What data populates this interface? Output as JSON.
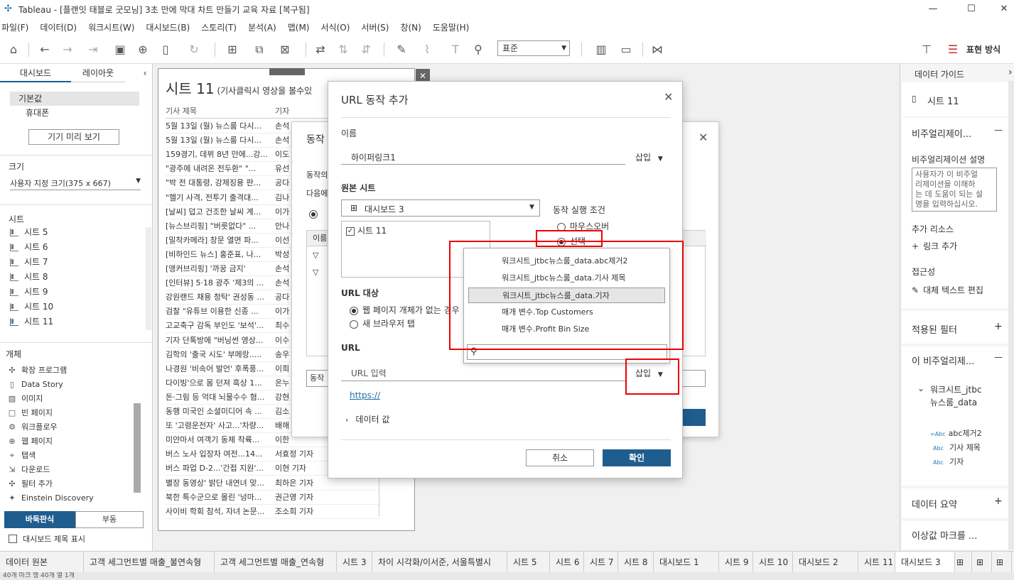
{
  "window": {
    "title": "Tableau - [플랜잇 태블로 굿모닝] 3초 만에 막대 차트 만들기 교육 자료 [복구됨]",
    "minimize": "—",
    "maximize": "☐",
    "close": "✕"
  },
  "menu": [
    "파일(F)",
    "데이터(D)",
    "워크시트(W)",
    "대시보드(B)",
    "스토리(T)",
    "분석(A)",
    "맵(M)",
    "서식(O)",
    "서버(S)",
    "창(N)",
    "도움말(H)"
  ],
  "toolbar": {
    "view_size": "표준",
    "show_me": "표현 방식"
  },
  "left": {
    "tab_dashboard": "대시보드",
    "tab_layout": "레이아웃",
    "device_default": "기본값",
    "device_phone": "휴대폰",
    "preview_button": "기기 미리 보기",
    "size_title": "크기",
    "size_value": "사용자 지정 크기(375 x 667)",
    "sheets_title": "시트",
    "sheets": [
      "시트 5",
      "시트 6",
      "시트 7",
      "시트 8",
      "시트 9",
      "시트 10",
      "시트 11"
    ],
    "objects_title": "개체",
    "objects": [
      "확장 프로그램",
      "Data Story",
      "이미지",
      "빈 페이지",
      "워크플로우",
      "웹 페이지",
      "탭색",
      "다운로드",
      "필터 추가",
      "Einstein Discovery"
    ],
    "tiled": "바둑판식",
    "floating": "부동",
    "show_title": "대시보드 제목 표시"
  },
  "sheet": {
    "title": "시트 11",
    "subtitle": "(기사클릭시 영상을 볼수있",
    "col1": "기사 제목",
    "col2": "기자",
    "rows": [
      [
        "5월 13일 (월) 뉴스룸 다시...",
        "손석"
      ],
      [
        "5월 13일 (월) 뉴스룸 다시...",
        "손석"
      ],
      [
        "159경기, 데뷔 8년 만에...강...",
        "이도"
      ],
      [
        "\"광주에 내려온 전두환\" \"...",
        "유선"
      ],
      [
        "\"박 전 대통령, 강제징용 판...",
        "공다"
      ],
      [
        "\"헬기 사격, 전투기 출격대...",
        "김나"
      ],
      [
        "[날씨] 덥고 건조한 날씨 계...",
        "이가"
      ],
      [
        "[뉴스브리핑] \"버릇없다\" ...",
        "안나"
      ],
      [
        "[밀착카메라] 창문 열면 파...",
        "이선"
      ],
      [
        "[비하인드 뉴스] 홍준표, 나...",
        "박성"
      ],
      [
        "[앵커브리핑] '까꿍 금지'",
        "손석"
      ],
      [
        "[인터뷰] 5·18 광주 '제3의 ...",
        "손석"
      ],
      [
        "강원랜드 채용 청탁' 권성동 ...",
        "공다"
      ],
      [
        "검찰 \"유튜브 이용한 신종 ...",
        "이가"
      ],
      [
        "고교축구 감독 부인도 '보석'...",
        "최수"
      ],
      [
        "기자 단톡방에 \"버닝썬 영상...",
        "이수"
      ],
      [
        "김학의 '출국 시도' 부메랑.....",
        "송우"
      ],
      [
        "나경원 '비속어 발언' 후폭풍...",
        "이희"
      ],
      [
        "다이빙'으로 몸 던져 흑상 1...",
        "온누"
      ],
      [
        "돈·그림 등 억대 뇌물수수 혐...",
        "강현"
      ],
      [
        "동행 미국인 소셜미디어 속 ...",
        "김소"
      ],
      [
        "또 '고령운전자' 사고...'차량...",
        "배해"
      ],
      [
        "미얀마서 여객기 동체 착륙...",
        "이한"
      ],
      [
        "버스 노사 입장차 여전...14...",
        "서효정 기자"
      ],
      [
        "버스 파업 D-2...'간접 지원'...",
        "이현 기자"
      ],
      [
        "별장 동영상' 밝단 내연녀 맞...",
        "최하은 기자"
      ],
      [
        "북한 특수군으로 몰린 '넝마...",
        "권근영 기자"
      ],
      [
        "사이비 학회 참석, 자녀 논문...",
        "조소희 기자"
      ]
    ]
  },
  "action_dialog": {
    "title": "동작",
    "line1": "동작의",
    "line2": "다음에",
    "col_name": "이름",
    "action_btn": "동작"
  },
  "url_dialog": {
    "title": "URL 동작 추가",
    "name_label": "이름",
    "name_value": "하이퍼링크1",
    "insert": "삽입",
    "source_label": "원본 시트",
    "source_value": "대시보드 3",
    "source_sheet": "시트 11",
    "run_label": "동작 실행 조건",
    "run_hover": "마우스오버",
    "run_select": "선택",
    "target_label": "URL 대상",
    "target_1": "웹 페이지 개체가 없는 경우",
    "target_2": "새 브라우저 탭",
    "url_label": "URL",
    "url_placeholder": "URL 입력",
    "url_preview": "https://",
    "data_values": "데이터 값",
    "cancel": "취소",
    "ok": "확인"
  },
  "insert_menu": [
    "워크시트_jtbc뉴스룸_data.abc제거2",
    "워크시트_jtbc뉴스룸_data.기사 제목",
    "워크시트_jtbc뉴스룸_data.기자",
    "매개 변수.Top Customers",
    "매개 변수.Profit Bin Size"
  ],
  "right": {
    "guide_title": "데이터 가이드",
    "sheet": "시트 11",
    "viz_section": "비주얼리제이...",
    "viz_desc_label": "비주얼리제이션 설명",
    "viz_desc_text": [
      "사용자가 이 비주얼",
      "리제이션을 이해하",
      "는 데 도움이 되는 설",
      "명을 입력하십시오."
    ],
    "resources": "추가 리소스",
    "add_link": "링크 추가",
    "accessibility": "접근성",
    "alt_text": "대체 텍스트 편집",
    "filters": "적용된 필터",
    "this_viz": "이 비주얼리제...",
    "datasource": [
      "워크시트_jtbc",
      "뉴스룸_data"
    ],
    "fields": [
      "abc제거2",
      "기사 제목",
      "기자"
    ],
    "data_summary": "데이터 요약",
    "outliers": "이상값 마크를 ..."
  },
  "tabs": [
    "데이터 원본",
    "고객 세그먼트별 매출_불연속형",
    "고객 세그먼트별 매출_연속형",
    "시트 3",
    "차이 시각화/이서준, 서울특별시",
    "시트 5",
    "시트 6",
    "시트 7",
    "시트 8",
    "대시보드 1",
    "시트 9",
    "시트 10",
    "대시보드 2",
    "시트 11",
    "대시보드 3"
  ],
  "status": "40개 마크   행 40개   열 1개"
}
